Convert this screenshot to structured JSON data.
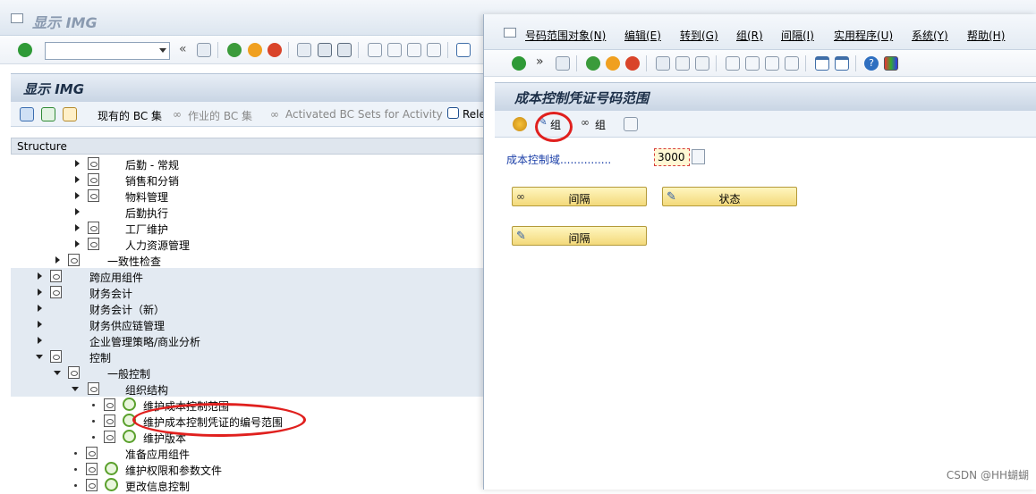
{
  "back_window": {
    "title": "显示 IMG",
    "toolbar": {
      "command_field_value": "",
      "nav_chevron": "«"
    },
    "img_header": {
      "title": "显示 IMG"
    },
    "img_toolbar": {
      "existing_bc_sets": "现有的 BC 集",
      "activity_bc_sets": "作业的 BC 集",
      "activated_bc_sets": "Activated BC Sets for Activity",
      "release_notes": "Rele"
    },
    "structure_header": "Structure",
    "tree": [
      {
        "label": "后勤 - 常规"
      },
      {
        "label": "销售和分销"
      },
      {
        "label": "物料管理"
      },
      {
        "label": "后勤执行"
      },
      {
        "label": "工厂维护"
      },
      {
        "label": "人力资源管理"
      },
      {
        "label": "一致性检查"
      },
      {
        "label": "跨应用组件"
      },
      {
        "label": "财务会计"
      },
      {
        "label": "财务会计（新）"
      },
      {
        "label": "财务供应链管理"
      },
      {
        "label": "企业管理策略/商业分析"
      },
      {
        "label": "控制"
      },
      {
        "label": "一般控制"
      },
      {
        "label": "组织结构"
      },
      {
        "label": "维护成本控制范围"
      },
      {
        "label": "维护成本控制凭证的编号范围"
      },
      {
        "label": "维护版本"
      },
      {
        "label": "准备应用组件"
      },
      {
        "label": "维护权限和参数文件"
      },
      {
        "label": "更改信息控制"
      }
    ]
  },
  "front_window": {
    "menu": [
      {
        "label": "号码范围对象(N)"
      },
      {
        "label": "编辑(E)"
      },
      {
        "label": "转到(G)"
      },
      {
        "label": "组(R)"
      },
      {
        "label": "间隔(I)"
      },
      {
        "label": "实用程序(U)"
      },
      {
        "label": "系统(Y)"
      },
      {
        "label": "帮助(H)"
      }
    ],
    "toolbar": {
      "nav_chevron": "»"
    },
    "header": {
      "title": "成本控制凭证号码范围"
    },
    "app_toolbar": {
      "change_group": "组",
      "display_group": "组"
    },
    "field": {
      "label": "成本控制域...............",
      "value": "3000"
    },
    "buttons": {
      "display_interval": "间隔",
      "status": "状态",
      "change_interval": "间隔"
    }
  },
  "watermark": "CSDN @HH蝴蝴",
  "colors": {
    "highlight_red": "#e0201e",
    "button_yellow": "#f3d97a",
    "label_blue": "#1b3fa8"
  }
}
